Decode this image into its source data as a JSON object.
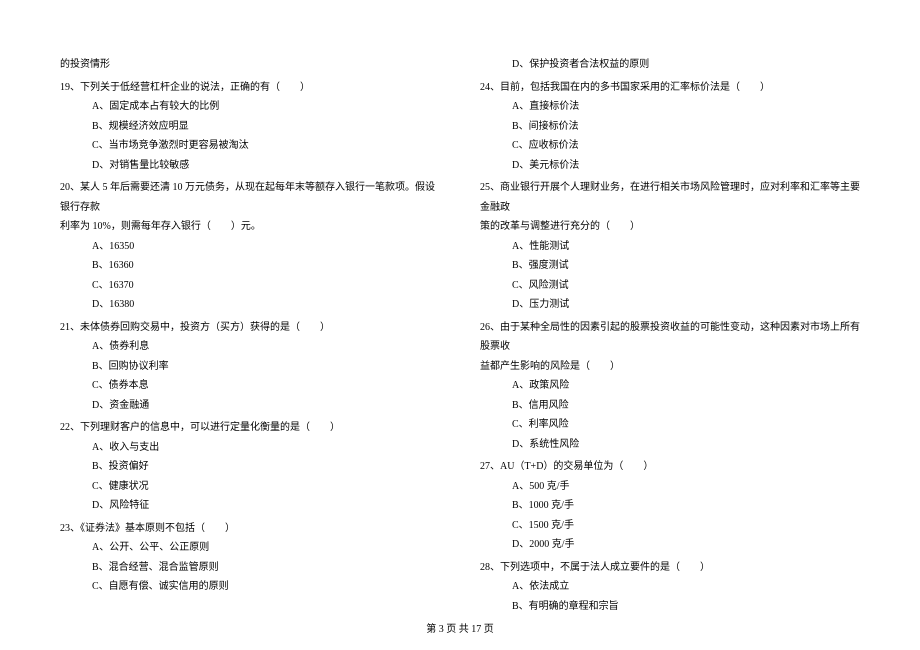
{
  "left_column": {
    "continued_text": "的投资情形",
    "questions": [
      {
        "number": "19、",
        "stem": "下列关于低经营杠杆企业的说法，正确的有（　　）",
        "options": [
          "A、固定成本占有较大的比例",
          "B、规模经济效应明显",
          "C、当市场竞争激烈时更容易被淘汰",
          "D、对销售量比较敏感"
        ]
      },
      {
        "number": "20、",
        "stem_line1": "某人 5 年后需要还清 10 万元债务，从现在起每年末等额存入银行一笔款项。假设银行存款",
        "stem_line2": "利率为 10%，则需每年存入银行（　　）元。",
        "options": [
          "A、16350",
          "B、16360",
          "C、16370",
          "D、16380"
        ]
      },
      {
        "number": "21、",
        "stem": "未体债券回购交易中，投资方（买方）获得的是（　　）",
        "options": [
          "A、债券利息",
          "B、回购协议利率",
          "C、债券本息",
          "D、资金融通"
        ]
      },
      {
        "number": "22、",
        "stem": "下列理财客户的信息中，可以进行定量化衡量的是（　　）",
        "options": [
          "A、收入与支出",
          "B、投资偏好",
          "C、健康状况",
          "D、风险特征"
        ]
      },
      {
        "number": "23、",
        "stem": "《证券法》基本原则不包括（　　）",
        "options": [
          "A、公开、公平、公正原则",
          "B、混合经营、混合监管原则",
          "C、自愿有偿、诚实信用的原则"
        ]
      }
    ]
  },
  "right_column": {
    "continued_option": "D、保护投资者合法权益的原则",
    "questions": [
      {
        "number": "24、",
        "stem": "目前，包括我国在内的多书国家采用的汇率标价法是（　　）",
        "options": [
          "A、直接标价法",
          "B、间接标价法",
          "C、应收标价法",
          "D、美元标价法"
        ]
      },
      {
        "number": "25、",
        "stem_line1": "商业银行开展个人理财业务，在进行相关市场风险管理时，应对利率和汇率等主要金融政",
        "stem_line2": "策的改革与调整进行充分的（　　）",
        "options": [
          "A、性能测试",
          "B、强度测试",
          "C、风险测试",
          "D、压力测试"
        ]
      },
      {
        "number": "26、",
        "stem_line1": "由于某种全局性的因素引起的股票投资收益的可能性变动，这种因素对市场上所有股票收",
        "stem_line2": "益都产生影响的风险是（　　）",
        "options": [
          "A、政策风险",
          "B、信用风险",
          "C、利率风险",
          "D、系统性风险"
        ]
      },
      {
        "number": "27、",
        "stem": "AU（T+D）的交易单位为（　　）",
        "options": [
          "A、500 克/手",
          "B、1000 克/手",
          "C、1500 克/手",
          "D、2000 克/手"
        ]
      },
      {
        "number": "28、",
        "stem": "下列选项中，不属于法人成立要件的是（　　）",
        "options": [
          "A、依法成立",
          "B、有明确的章程和宗旨"
        ]
      }
    ]
  },
  "footer": {
    "text": "第 3 页 共 17 页"
  }
}
